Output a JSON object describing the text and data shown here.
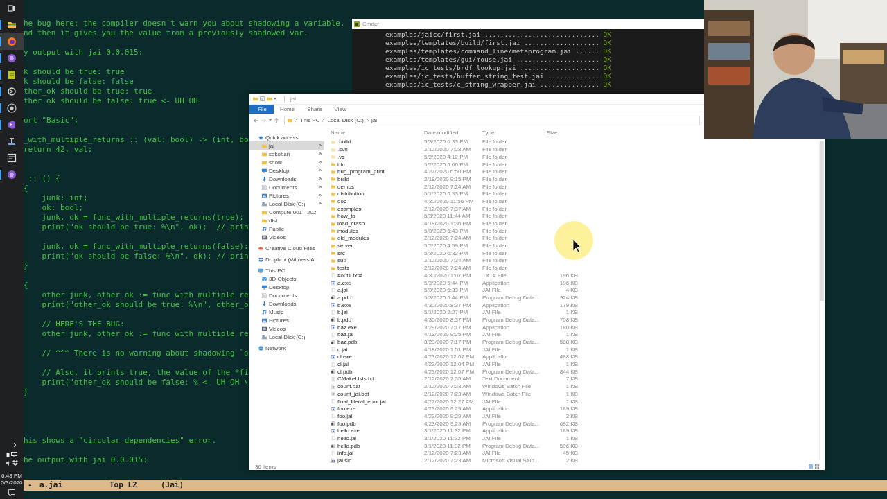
{
  "taskbar": {
    "apps": [
      {
        "kind": "taskview",
        "running": false,
        "active": false
      },
      {
        "kind": "folder",
        "running": true,
        "active": false
      },
      {
        "kind": "browser",
        "running": true,
        "active": true
      },
      {
        "kind": "orb",
        "running": true,
        "active": false
      },
      {
        "kind": "notes",
        "running": true,
        "active": false
      },
      {
        "kind": "terminal",
        "running": true,
        "active": false
      },
      {
        "kind": "aperture",
        "running": true,
        "active": false
      },
      {
        "kind": "studio",
        "running": true,
        "active": false
      },
      {
        "kind": "tool",
        "running": false,
        "active": false
      },
      {
        "kind": "panel",
        "running": false,
        "active": false
      },
      {
        "kind": "orb",
        "running": true,
        "active": false
      }
    ],
    "clock_time": "6:48 PM",
    "clock_date": "5/3/2020"
  },
  "editor": {
    "lines": [
      {
        "kind": "code",
        "text": "he bug here: the compiler doesn't warn you about shadowing a variable."
      },
      {
        "kind": "code",
        "text": "nd then it gives you the value from a previously shadowed var."
      },
      {
        "kind": "blank"
      },
      {
        "kind": "code",
        "text": "y output with jai 0.0.015:"
      },
      {
        "kind": "blank"
      },
      {
        "kind": "code",
        "text": "k should be true: true"
      },
      {
        "kind": "code",
        "text": "k should be false: false"
      },
      {
        "kind": "code",
        "text": "ther_ok should be true: true"
      },
      {
        "kind": "code",
        "text": "ther_ok should be false: true <- UH OH"
      },
      {
        "kind": "blank"
      },
      {
        "kind": "code",
        "text": "ort \"Basic\";"
      },
      {
        "kind": "blank"
      },
      {
        "kind": "code",
        "text": "_with_multiple_returns :: (val: bool) -> (int, bo"
      },
      {
        "kind": "code",
        "text": "return 42, val;"
      },
      {
        "kind": "blank"
      },
      {
        "kind": "blank"
      },
      {
        "kind": "code",
        "text": " :: () {"
      },
      {
        "kind": "code",
        "text": "{"
      },
      {
        "kind": "code",
        "text": "    junk: int;"
      },
      {
        "kind": "code",
        "text": "    ok: bool;"
      },
      {
        "kind": "code",
        "text": "    junk, ok = func_with_multiple_returns(true);"
      },
      {
        "kind": "code",
        "text": "    print(\"ok should be true: %\\n\", ok);  // prin"
      },
      {
        "kind": "blank"
      },
      {
        "kind": "code",
        "text": "    junk, ok = func_with_multiple_returns(false);"
      },
      {
        "kind": "code",
        "text": "    print(\"ok should be false: %\\n\", ok); // prin"
      },
      {
        "kind": "code",
        "text": "}"
      },
      {
        "kind": "blank"
      },
      {
        "kind": "code",
        "text": "{"
      },
      {
        "kind": "code",
        "text": "    other_junk, other_ok := func_with_multiple_re"
      },
      {
        "kind": "code",
        "text": "    print(\"other_ok should be true: %\\n\", other_o"
      },
      {
        "kind": "blank"
      },
      {
        "kind": "code",
        "text": "    // HERE'S THE BUG:"
      },
      {
        "kind": "code",
        "text": "    other_junk, other_ok := func_with_multiple_re"
      },
      {
        "kind": "blank"
      },
      {
        "kind": "code",
        "text": "    // ^^^ There is no warning about shadowing `o"
      },
      {
        "kind": "blank"
      },
      {
        "kind": "code",
        "text": "    // Also, it prints true, the value of the *fi"
      },
      {
        "kind": "code",
        "text": "    print(\"other_ok should be false: % <- UH OH \\"
      },
      {
        "kind": "code",
        "text": "}"
      },
      {
        "kind": "blank"
      },
      {
        "kind": "blank"
      },
      {
        "kind": "blank"
      },
      {
        "kind": "blank"
      },
      {
        "kind": "code",
        "text": "his shows a \"circular dependencies\" error."
      },
      {
        "kind": "blank"
      },
      {
        "kind": "code",
        "text": "he output with jai 0.0.015:"
      }
    ],
    "mode_line": {
      "state": "-",
      "buffer": "a.jai",
      "position": "Top L2",
      "mode": "(Jai)"
    }
  },
  "console": {
    "title": "Cmder",
    "lines": [
      {
        "text": "examples/jaicc/first.jai .............................",
        "status": "OK"
      },
      {
        "text": "examples/templates/build/first.jai ...................",
        "status": "OK"
      },
      {
        "text": "examples/templates/command_line/metaprogram.jai ......",
        "status": "OK"
      },
      {
        "text": "examples/templates/gui/mouse.jai .....................",
        "status": "OK"
      },
      {
        "text": "examples/ic_tests/brdf_lookup.jai ....................",
        "status": "OK"
      },
      {
        "text": "examples/ic_tests/buffer_string_test.jai .............",
        "status": "OK"
      },
      {
        "text": "examples/ic_tests/c_string_wrapper.jai ...............",
        "status": "OK"
      }
    ]
  },
  "explorer": {
    "title": "jai",
    "ribbon_tabs": [
      {
        "label": "File",
        "kind": "menu"
      },
      {
        "label": "Home",
        "kind": "tab"
      },
      {
        "label": "Share",
        "kind": "tab"
      },
      {
        "label": "View",
        "kind": "tab"
      }
    ],
    "breadcrumb": [
      "This PC",
      "Local Disk (C:)",
      "jai"
    ],
    "navigation": [
      {
        "label": "Quick access",
        "kind": "star",
        "selected": false,
        "children": [
          {
            "label": "jai",
            "kind": "folder",
            "selected": true,
            "pinned": true
          },
          {
            "label": "sokoban",
            "kind": "folder",
            "selected": false,
            "pinned": true
          },
          {
            "label": "show",
            "kind": "folder",
            "selected": false,
            "pinned": true
          },
          {
            "label": "Desktop",
            "kind": "desktop",
            "selected": false,
            "pinned": true
          },
          {
            "label": "Downloads",
            "kind": "download",
            "selected": false,
            "pinned": true
          },
          {
            "label": "Documents",
            "kind": "document",
            "selected": false,
            "pinned": true
          },
          {
            "label": "Pictures",
            "kind": "picture",
            "selected": false,
            "pinned": true
          },
          {
            "label": "Local Disk (C:)",
            "kind": "drive",
            "selected": false,
            "pinned": true
          },
          {
            "label": "Compute 001 - 202",
            "kind": "folder",
            "selected": false,
            "pinned": false
          },
          {
            "label": "dist",
            "kind": "folder",
            "selected": false,
            "pinned": false
          },
          {
            "label": "Public",
            "kind": "music",
            "selected": false,
            "pinned": false
          },
          {
            "label": "Videos",
            "kind": "video",
            "selected": false,
            "pinned": false
          }
        ]
      },
      {
        "label": "Creative Cloud Files",
        "kind": "cloud",
        "selected": false
      },
      {
        "label": "Dropbox (Witness Ar",
        "kind": "dropbox",
        "selected": false
      },
      {
        "label": "This PC",
        "kind": "pc",
        "selected": false,
        "children": [
          {
            "label": "3D Objects",
            "kind": "cube",
            "selected": false
          },
          {
            "label": "Desktop",
            "kind": "desktop",
            "selected": false
          },
          {
            "label": "Documents",
            "kind": "document",
            "selected": false
          },
          {
            "label": "Downloads",
            "kind": "download",
            "selected": false
          },
          {
            "label": "Music",
            "kind": "music",
            "selected": false
          },
          {
            "label": "Pictures",
            "kind": "picture",
            "selected": false
          },
          {
            "label": "Videos",
            "kind": "video",
            "selected": false
          },
          {
            "label": "Local Disk (C:)",
            "kind": "drive",
            "selected": false
          }
        ]
      },
      {
        "label": "Network",
        "kind": "network",
        "selected": false
      }
    ],
    "columns": [
      "Name",
      "Date modified",
      "Type",
      "Size"
    ],
    "files": [
      {
        "name": ".build",
        "date": "5/3/2020 6:33 PM",
        "type": "File folder",
        "kind": "hidden-folder"
      },
      {
        "name": ".svn",
        "date": "2/12/2020 7:23 AM",
        "type": "File folder",
        "kind": "hidden-folder"
      },
      {
        "name": ".vs",
        "date": "5/2/2020 4:12 PM",
        "type": "File folder",
        "kind": "hidden-folder"
      },
      {
        "name": "bin",
        "date": "5/2/2020 5:00 PM",
        "type": "File folder",
        "kind": "folder"
      },
      {
        "name": "bug_program_print",
        "date": "4/27/2020 6:50 PM",
        "type": "File folder",
        "kind": "folder"
      },
      {
        "name": "build",
        "date": "2/18/2020 9:15 PM",
        "type": "File folder",
        "kind": "folder"
      },
      {
        "name": "demos",
        "date": "2/12/2020 7:24 AM",
        "type": "File folder",
        "kind": "folder"
      },
      {
        "name": "distribution",
        "date": "5/1/2020 6:33 PM",
        "type": "File folder",
        "kind": "folder"
      },
      {
        "name": "doc",
        "date": "4/30/2020 11:56 PM",
        "type": "File folder",
        "kind": "folder"
      },
      {
        "name": "examples",
        "date": "2/12/2020 7:37 AM",
        "type": "File folder",
        "kind": "folder"
      },
      {
        "name": "how_to",
        "date": "5/3/2020 11:44 AM",
        "type": "File folder",
        "kind": "folder"
      },
      {
        "name": "load_crash",
        "date": "4/18/2020 1:36 PM",
        "type": "File folder",
        "kind": "folder"
      },
      {
        "name": "modules",
        "date": "5/3/2020 5:43 PM",
        "type": "File folder",
        "kind": "folder"
      },
      {
        "name": "old_modules",
        "date": "2/12/2020 7:24 AM",
        "type": "File folder",
        "kind": "folder"
      },
      {
        "name": "server",
        "date": "5/2/2020 4:59 PM",
        "type": "File folder",
        "kind": "folder"
      },
      {
        "name": "src",
        "date": "5/3/2020 6:32 PM",
        "type": "File folder",
        "kind": "folder"
      },
      {
        "name": "sup",
        "date": "2/12/2020 7:34 AM",
        "type": "File folder",
        "kind": "folder"
      },
      {
        "name": "tests",
        "date": "2/12/2020 7:24 AM",
        "type": "File folder",
        "kind": "folder"
      },
      {
        "name": "#out1.txt#",
        "date": "4/30/2020 1:07 PM",
        "type": "TXT# File",
        "size": "196 KB",
        "kind": "file"
      },
      {
        "name": "a.exe",
        "date": "5/3/2020 5:44 PM",
        "type": "Application",
        "size": "196 KB",
        "kind": "exe"
      },
      {
        "name": "a.jai",
        "date": "5/3/2020 6:33 PM",
        "type": "JAI File",
        "size": "4 KB",
        "kind": "file"
      },
      {
        "name": "a.pdb",
        "date": "5/3/2020 5:44 PM",
        "type": "Program Debug Data...",
        "size": "924 KB",
        "kind": "pdb"
      },
      {
        "name": "b.exe",
        "date": "4/30/2020 8:37 PM",
        "type": "Application",
        "size": "179 KB",
        "kind": "exe"
      },
      {
        "name": "b.jai",
        "date": "5/1/2020 2:27 PM",
        "type": "JAI File",
        "size": "1 KB",
        "kind": "file"
      },
      {
        "name": "b.pdb",
        "date": "4/30/2020 8:37 PM",
        "type": "Program Debug Data...",
        "size": "708 KB",
        "kind": "pdb"
      },
      {
        "name": "baz.exe",
        "date": "3/29/2020 7:17 PM",
        "type": "Application",
        "size": "180 KB",
        "kind": "exe"
      },
      {
        "name": "baz.jai",
        "date": "4/13/2020 9:25 PM",
        "type": "JAI File",
        "size": "1 KB",
        "kind": "file"
      },
      {
        "name": "baz.pdb",
        "date": "3/29/2020 7:17 PM",
        "type": "Program Debug Data...",
        "size": "588 KB",
        "kind": "pdb"
      },
      {
        "name": "c.jai",
        "date": "4/18/2020 1:51 PM",
        "type": "JAI File",
        "size": "1 KB",
        "kind": "file"
      },
      {
        "name": "cl.exe",
        "date": "4/23/2020 12:07 PM",
        "type": "Application",
        "size": "488 KB",
        "kind": "exe"
      },
      {
        "name": "cl.jai",
        "date": "4/23/2020 12:04 PM",
        "type": "JAI File",
        "size": "1 KB",
        "kind": "file"
      },
      {
        "name": "cl.pdb",
        "date": "4/23/2020 12:07 PM",
        "type": "Program Debug Data...",
        "size": "844 KB",
        "kind": "pdb"
      },
      {
        "name": "CMakeLists.txt",
        "date": "2/12/2020 7:35 AM",
        "type": "Text Document",
        "size": "7 KB",
        "kind": "text"
      },
      {
        "name": "count.bat",
        "date": "2/12/2020 7:23 AM",
        "type": "Windows Batch File",
        "size": "1 KB",
        "kind": "bat"
      },
      {
        "name": "count_jai.bat",
        "date": "2/12/2020 7:23 AM",
        "type": "Windows Batch File",
        "size": "1 KB",
        "kind": "bat"
      },
      {
        "name": "float_literal_error.jai",
        "date": "4/27/2020 12:27 AM",
        "type": "JAI File",
        "size": "1 KB",
        "kind": "file"
      },
      {
        "name": "foo.exe",
        "date": "4/23/2020 9:29 AM",
        "type": "Application",
        "size": "189 KB",
        "kind": "exe"
      },
      {
        "name": "foo.jai",
        "date": "4/23/2020 9:29 AM",
        "type": "JAI File",
        "size": "3 KB",
        "kind": "file"
      },
      {
        "name": "foo.pdb",
        "date": "4/23/2020 9:29 AM",
        "type": "Program Debug Data...",
        "size": "692 KB",
        "kind": "pdb"
      },
      {
        "name": "hello.exe",
        "date": "3/1/2020 11:32 PM",
        "type": "Application",
        "size": "189 KB",
        "kind": "exe"
      },
      {
        "name": "hello.jai",
        "date": "3/1/2020 11:32 PM",
        "type": "JAI File",
        "size": "1 KB",
        "kind": "file"
      },
      {
        "name": "hello.pdb",
        "date": "3/1/2020 11:32 PM",
        "type": "Program Debug Data...",
        "size": "596 KB",
        "kind": "pdb"
      },
      {
        "name": "info.jai",
        "date": "2/12/2020 7:23 AM",
        "type": "JAI File",
        "size": "45 KB",
        "kind": "file"
      },
      {
        "name": "jai.sln",
        "date": "2/12/2020 7:23 AM",
        "type": "Microsoft Visual Stud...",
        "size": "2 KB",
        "kind": "sln"
      }
    ],
    "status_bar": "36 items"
  }
}
